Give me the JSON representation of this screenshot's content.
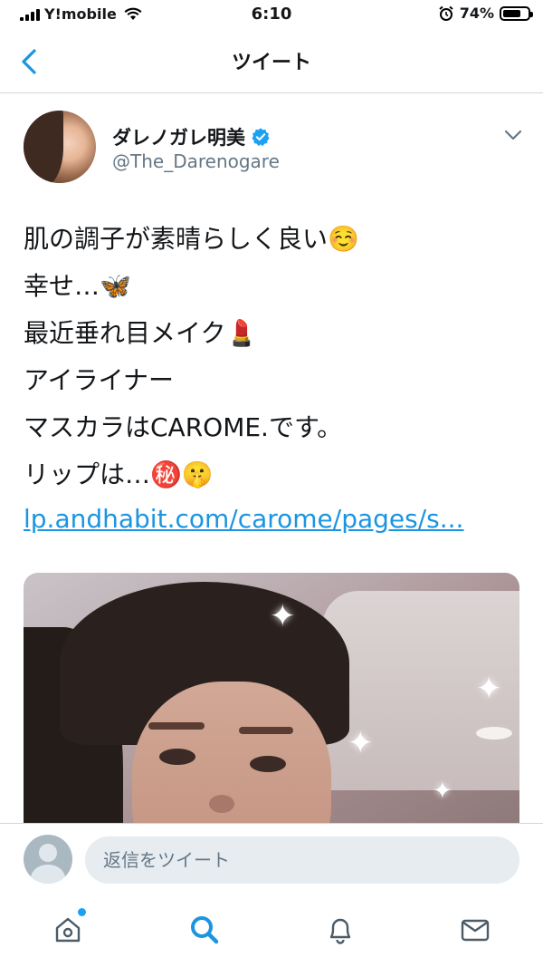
{
  "status_bar": {
    "carrier": "Y!mobile",
    "time": "6:10",
    "battery_percent_text": "74%",
    "battery_level": 0.74
  },
  "nav": {
    "title": "ツイート",
    "back_icon": "chevron-left-icon"
  },
  "tweet": {
    "author_name": "ダレノガレ明美",
    "verified": true,
    "author_handle": "@The_Darenogare",
    "text": "肌の調子が素晴らしく良い☺️\n幸せ…🦋\n最近垂れ目メイク💄\nアイライナー\nマスカラはCAROME.です。\nリップは…㊙️🤫",
    "link_text": "lp.andhabit.com/carome/pages/s..."
  },
  "reply": {
    "placeholder": "返信をツイート"
  },
  "tabs": [
    {
      "name": "home",
      "icon": "home-icon",
      "has_notification": true
    },
    {
      "name": "search",
      "icon": "search-icon",
      "active": true
    },
    {
      "name": "notifications",
      "icon": "bell-icon"
    },
    {
      "name": "messages",
      "icon": "mail-icon"
    }
  ],
  "colors": {
    "accent": "#1da1f2",
    "link": "#1b95e0",
    "nav_icon": "#1b95e0",
    "secondary_text": "#657786"
  }
}
